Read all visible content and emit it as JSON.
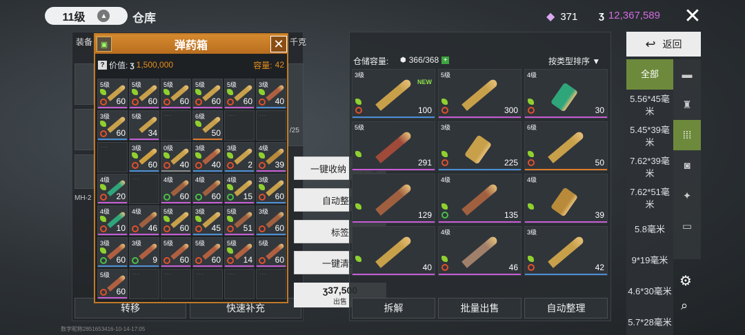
{
  "topbar": {
    "level": "11级",
    "warehouse": "仓库",
    "gems": "371",
    "coins": "12,367,589"
  },
  "left_panel": {
    "equip_label": "装备",
    "tick_label": "千克",
    "side_label_1": "/25",
    "side_label_2": "MH-2",
    "buttons": [
      "转移",
      "快速补充"
    ]
  },
  "ammo_box": {
    "title": "弹药箱",
    "value_label": "价值:",
    "value": "1,500,000",
    "capacity_label": "容量:",
    "capacity": "42",
    "items": [
      {
        "grade": "5级",
        "count": "60",
        "ind": "ban",
        "leaf": true,
        "color": "#c8a04a",
        "bar": "#c85bd6"
      },
      {
        "grade": "5级",
        "count": "60",
        "ind": "ban",
        "leaf": true,
        "color": "#c8a04a",
        "bar": "#c85bd6"
      },
      {
        "grade": "5级",
        "count": "60",
        "ind": "ban",
        "leaf": true,
        "color": "#c8a04a",
        "bar": "#c85bd6"
      },
      {
        "grade": "5级",
        "count": "60",
        "ind": "ban",
        "leaf": true,
        "color": "#c8a04a",
        "bar": "#c85bd6"
      },
      {
        "grade": "5级",
        "count": "60",
        "ind": "ban",
        "leaf": true,
        "color": "#c8a04a",
        "bar": "#c85bd6"
      },
      {
        "grade": "3级",
        "count": "40",
        "ind": "ban",
        "leaf": true,
        "color": "#b06040",
        "bar": "#4a8ed6"
      },
      {
        "grade": "3级",
        "count": "60",
        "ind": "ban",
        "leaf": true,
        "color": "#c8a04a",
        "bar": "#4a8ed6"
      },
      {
        "grade": "5级",
        "count": "34",
        "ind": "",
        "leaf": false,
        "color": "#c8a04a",
        "bar": "#c85bd6"
      },
      {
        "empty": true
      },
      {
        "grade": "6级",
        "count": "50",
        "ind": "",
        "leaf": true,
        "color": "#c8a04a",
        "bar": "#e07a2a"
      },
      {
        "empty": true
      },
      {
        "empty": true
      },
      {
        "empty": true
      },
      {
        "grade": "3级",
        "count": "60",
        "ind": "ban",
        "leaf": true,
        "color": "#d0a040",
        "bar": "#4a8ed6"
      },
      {
        "grade": "0级",
        "count": "40",
        "ind": "ban",
        "leaf": true,
        "color": "#c8a04a",
        "bar": "#888"
      },
      {
        "grade": "3级",
        "count": "40",
        "ind": "ban",
        "leaf": true,
        "color": "#b06040",
        "bar": "#4a8ed6"
      },
      {
        "grade": "3级",
        "count": "2",
        "ind": "ban",
        "leaf": true,
        "color": "#c8a04a",
        "bar": "#4a8ed6"
      },
      {
        "grade": "4级",
        "count": "39",
        "ind": "ban",
        "leaf": true,
        "color": "#b88a3a",
        "bar": "#c85bd6"
      },
      {
        "grade": "4级",
        "count": "20",
        "ind": "ban",
        "leaf": true,
        "color": "#2fa57a",
        "bar": "#c85bd6"
      },
      {
        "empty": true
      },
      {
        "grade": "4级",
        "count": "60",
        "ind": "ok",
        "leaf": false,
        "color": "#a06040",
        "bar": "#c85bd6"
      },
      {
        "grade": "4级",
        "count": "60",
        "ind": "ok",
        "leaf": false,
        "color": "#a06040",
        "bar": "#c85bd6"
      },
      {
        "grade": "4级",
        "count": "15",
        "ind": "ok",
        "leaf": true,
        "color": "#c8a04a",
        "bar": "#c85bd6"
      },
      {
        "grade": "3级",
        "count": "60",
        "ind": "ban",
        "leaf": true,
        "color": "#c8a04a",
        "bar": "#4a8ed6"
      },
      {
        "grade": "4级",
        "count": "10",
        "ind": "ban",
        "leaf": true,
        "color": "#2fa57a",
        "bar": "#c85bd6"
      },
      {
        "grade": "4级",
        "count": "46",
        "ind": "ban",
        "leaf": false,
        "color": "#a06040",
        "bar": "#c85bd6"
      },
      {
        "grade": "5级",
        "count": "60",
        "ind": "ban",
        "leaf": true,
        "color": "#c8a04a",
        "bar": "#c85bd6"
      },
      {
        "grade": "3级",
        "count": "45",
        "ind": "ban",
        "leaf": true,
        "color": "#c8a04a",
        "bar": "#4a8ed6"
      },
      {
        "grade": "5级",
        "count": "51",
        "ind": "ban",
        "leaf": true,
        "color": "#a06040",
        "bar": "#c85bd6"
      },
      {
        "grade": "3级",
        "count": "60",
        "ind": "ban",
        "leaf": false,
        "color": "#a06040",
        "bar": "#4a8ed6"
      },
      {
        "grade": "3级",
        "count": "60",
        "ind": "ok",
        "leaf": true,
        "color": "#b06040",
        "bar": "#4a8ed6"
      },
      {
        "grade": "3级",
        "count": "9",
        "ind": "ok",
        "leaf": false,
        "color": "#b06040",
        "bar": "#4a8ed6"
      },
      {
        "grade": "5级",
        "count": "60",
        "ind": "ban",
        "leaf": false,
        "color": "#b06040",
        "bar": "#c85bd6"
      },
      {
        "grade": "5级",
        "count": "60",
        "ind": "ban",
        "leaf": false,
        "color": "#b06040",
        "bar": "#c85bd6"
      },
      {
        "grade": "5级",
        "count": "14",
        "ind": "ban",
        "leaf": true,
        "color": "#b06040",
        "bar": "#c85bd6"
      },
      {
        "grade": "5级",
        "count": "60",
        "ind": "ban",
        "leaf": false,
        "color": "#b06040",
        "bar": "#c85bd6"
      },
      {
        "grade": "5级",
        "count": "60",
        "ind": "ban",
        "leaf": false,
        "color": "#b06040",
        "bar": "#c85bd6"
      },
      {
        "empty": true
      },
      {
        "empty": true
      },
      {
        "empty": true
      },
      {
        "empty": true
      },
      {
        "empty": true
      }
    ]
  },
  "menu": {
    "collect": "一键收纳",
    "auto_sort": "自动整理",
    "tag": "标签",
    "clear": "一键清空",
    "sell_price": "37,500",
    "sell_label": "出售"
  },
  "warehouse": {
    "capacity_label": "仓储容量:",
    "capacity": "366/368",
    "sort_label": "按类型排序",
    "new_label": "NEW",
    "items": [
      {
        "grade": "3级",
        "count": "100",
        "ind": "ban",
        "new": true,
        "shell": false,
        "color": "#c8a04a",
        "bar": "#4a8ed6"
      },
      {
        "grade": "5级",
        "count": "300",
        "ind": "ban",
        "new": false,
        "shell": false,
        "color": "#c8a04a",
        "bar": "#c85bd6"
      },
      {
        "grade": "4级",
        "count": "30",
        "ind": "ban",
        "new": false,
        "shell": true,
        "color": "#2fa57a",
        "bar": "#c85bd6"
      },
      {
        "grade": "5级",
        "count": "291",
        "ind": "",
        "new": false,
        "shell": false,
        "color": "#a04a3a",
        "bar": "#c85bd6"
      },
      {
        "grade": "3级",
        "count": "225",
        "ind": "ban",
        "new": false,
        "shell": true,
        "color": "#c8a04a",
        "bar": "#4a8ed6"
      },
      {
        "grade": "6级",
        "count": "50",
        "ind": "ban",
        "new": false,
        "shell": false,
        "color": "#c8a04a",
        "bar": "#e07a2a"
      },
      {
        "grade": "",
        "count": "129",
        "ind": "",
        "new": false,
        "shell": false,
        "color": "#a06040",
        "bar": "#c85bd6"
      },
      {
        "grade": "4级",
        "count": "135",
        "ind": "ok",
        "new": false,
        "shell": false,
        "color": "#a06040",
        "bar": "#c85bd6"
      },
      {
        "grade": "4级",
        "count": "39",
        "ind": "",
        "new": false,
        "shell": true,
        "color": "#b88a3a",
        "bar": "#c85bd6"
      },
      {
        "grade": "",
        "count": "40",
        "ind": "",
        "new": false,
        "shell": false,
        "color": "#c8a04a",
        "bar": "#c85bd6"
      },
      {
        "grade": "4级",
        "count": "46",
        "ind": "ban",
        "new": false,
        "shell": false,
        "color": "#a0806a",
        "bar": "#c85bd6"
      },
      {
        "grade": "3级",
        "count": "42",
        "ind": "ban",
        "new": false,
        "shell": false,
        "color": "#c8a04a",
        "bar": "#4a8ed6"
      }
    ],
    "buttons": [
      "拆解",
      "批量出售",
      "自动整理"
    ]
  },
  "sidebar": {
    "back": "返回",
    "categories": [
      "全部",
      "5.56*45毫米",
      "5.45*39毫米",
      "7.62*39毫米",
      "7.62*51毫米",
      "5.8毫米",
      "9*19毫米",
      "4.6*30毫米",
      "5.7*28毫米"
    ],
    "icons": [
      "pistol-icon",
      "armor-icon",
      "ammo-icon",
      "camera-icon",
      "wrench-icon",
      "box-icon"
    ]
  },
  "footer": "数字昵称2851653416-10-14-17:05"
}
